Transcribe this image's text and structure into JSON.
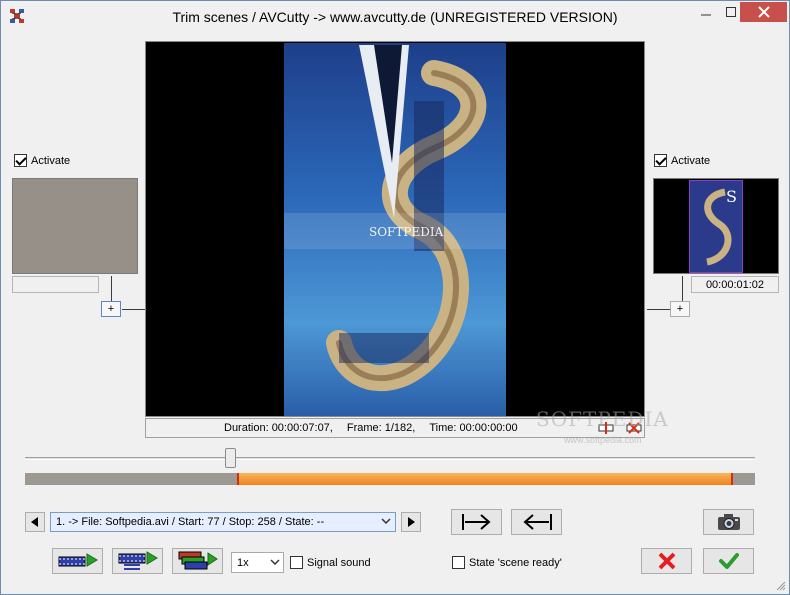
{
  "window": {
    "title": "Trim scenes / AVCutty -> www.avcutty.de (UNREGISTERED VERSION)",
    "icons": {
      "app": "app-icon",
      "minimize": "minimize-icon",
      "maximize": "maximize-icon",
      "close": "close-icon"
    },
    "accent": "#c7504b"
  },
  "preview": {
    "info": {
      "duration": "Duration: 00:00:07:07,",
      "frame": "Frame: 1/182,",
      "time": "Time: 00:00:00:00"
    },
    "buttons": [
      "set-marker-icon",
      "clear-marker-icon"
    ]
  },
  "watermark": {
    "text": "SOFTPEDIA",
    "sub": "www.softpedia.com"
  },
  "left_panel": {
    "activate_label": "Activate",
    "activate_checked": true,
    "time": "",
    "plus_label": "+"
  },
  "right_panel": {
    "activate_label": "Activate",
    "activate_checked": true,
    "time": "00:00:01:02",
    "plus_label": "+"
  },
  "timeline": {
    "slider_fraction": 0.29,
    "selection_start_fraction": 0.29,
    "selection_end_fraction": 0.97,
    "selection_color": "#f08320",
    "marker_color": "#d42c0f"
  },
  "scene_list": {
    "selected": "1. -> File: Softpedia.avi / Start: 77 / Stop: 258 / State: --",
    "prev_icon": "arrow-left-icon",
    "next_icon": "arrow-right-icon"
  },
  "jump_buttons": {
    "to_start_icon": "jump-to-start-marker-icon",
    "to_end_icon": "jump-to-end-marker-icon"
  },
  "playback": {
    "speed": "1x",
    "signal_sound_label": "Signal sound",
    "signal_sound_checked": false,
    "icons": [
      "play-film-icon",
      "play-scene-icon",
      "play-all-scenes-icon"
    ]
  },
  "state": {
    "label": "State 'scene ready'",
    "checked": false
  },
  "actions": {
    "snapshot_icon": "camera-icon",
    "cancel_icon": "cancel-x-icon",
    "ok_icon": "ok-check-icon",
    "cancel_color": "#e0201f",
    "ok_color": "#2e9b2e"
  }
}
